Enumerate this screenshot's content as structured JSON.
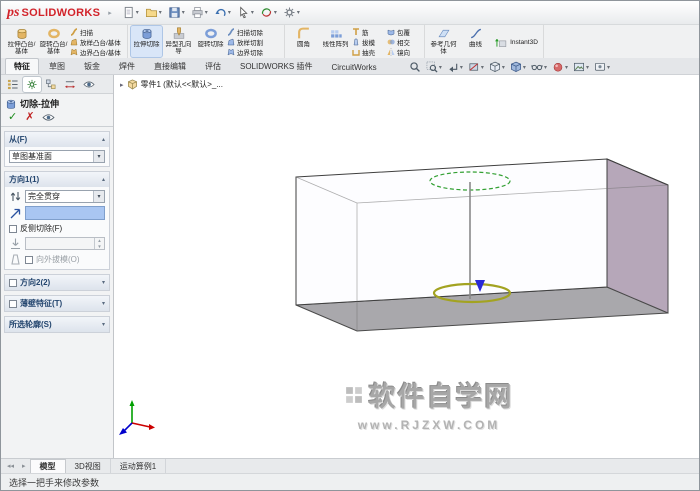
{
  "titlebar": {
    "logo_mark": "ps",
    "logo_text": "SOLIDWORKS"
  },
  "quick_access_icons": [
    "new-document-icon",
    "open-icon",
    "save-icon",
    "print-icon",
    "undo-icon",
    "select-icon",
    "rebuild-icon"
  ],
  "ribbon": {
    "groups": [
      {
        "items": [
          {
            "label": "拉伸凸台/基体",
            "icon": "boss-extrude-icon"
          },
          {
            "label": "旋转凸台/基体",
            "icon": "boss-revolve-icon"
          },
          {
            "items": [
              {
                "label": "扫描",
                "icon": "swept-boss-icon"
              },
              {
                "label": "放样凸台/基体",
                "icon": "lofted-boss-icon"
              },
              {
                "label": "边界凸台/基体",
                "icon": "boundary-boss-icon"
              }
            ]
          }
        ]
      },
      {
        "items": [
          {
            "label": "拉伸切除",
            "icon": "cut-extrude-icon",
            "active": true
          },
          {
            "label": "异型孔向导",
            "icon": "hole-wizard-icon"
          },
          {
            "label": "旋转切除",
            "icon": "cut-revolve-icon"
          },
          {
            "items": [
              {
                "label": "扫描切除",
                "icon": "swept-cut-icon"
              },
              {
                "label": "放样切割",
                "icon": "lofted-cut-icon"
              },
              {
                "label": "边界切除",
                "icon": "boundary-cut-icon"
              }
            ]
          }
        ]
      },
      {
        "items": [
          {
            "label": "圆角",
            "icon": "fillet-icon"
          },
          {
            "label": "线性阵列",
            "icon": "linear-pattern-icon"
          },
          {
            "items": [
              {
                "label": "筋",
                "icon": "rib-icon"
              },
              {
                "label": "拔模",
                "icon": "draft-icon"
              },
              {
                "label": "抽壳",
                "icon": "shell-icon"
              }
            ]
          },
          {
            "items": [
              {
                "label": "包覆",
                "icon": "wrap-icon"
              },
              {
                "label": "相交",
                "icon": "intersect-icon"
              },
              {
                "label": "镜向",
                "icon": "mirror-icon"
              }
            ]
          }
        ]
      },
      {
        "items": [
          {
            "label": "参考几何体",
            "icon": "reference-geometry-icon"
          },
          {
            "label": "曲线",
            "icon": "curves-icon"
          },
          {
            "label": "Instant3D",
            "icon": "instant3d-icon"
          }
        ]
      }
    ]
  },
  "tabs": [
    {
      "label": "特征",
      "active": true
    },
    {
      "label": "草图"
    },
    {
      "label": "钣金"
    },
    {
      "label": "焊件"
    },
    {
      "label": "直接编辑"
    },
    {
      "label": "评估"
    },
    {
      "label": "SOLIDWORKS 插件"
    },
    {
      "label": "CircuitWorks"
    }
  ],
  "heads_up_icons": [
    "zoom-to-fit-icon",
    "zoom-to-area-icon",
    "previous-view-icon",
    "section-view-icon",
    "view-orientation-icon",
    "display-style-icon",
    "hide-show-items-icon",
    "edit-appearance-icon",
    "apply-scene-icon",
    "view-settings-icon"
  ],
  "pm": {
    "tab_icons": [
      "feature-manager-icon",
      "property-manager-icon",
      "configuration-manager-icon",
      "dimxpert-manager-icon",
      "display-manager-icon"
    ],
    "title": "切除-拉伸",
    "sections": {
      "from": {
        "header": "从(F)",
        "value": "草图基准面"
      },
      "direction1": {
        "header": "方向1(1)",
        "end_condition": "完全贯穿",
        "flip_side": "反侧切除(F)",
        "depth": "",
        "draft": "向外拔模(O)"
      },
      "direction2": {
        "header": "方向2(2)"
      },
      "thin": {
        "header": "薄壁特征(T)"
      },
      "contours": {
        "header": "所选轮廓(S)"
      }
    }
  },
  "feature_tree": {
    "root_label": "零件1 (默认<<默认>_..."
  },
  "viewport": {
    "watermark_title": "软件自学网",
    "watermark_url": "www.RJZXW.COM"
  },
  "doc_tabs": [
    {
      "label": "模型",
      "active": true
    },
    {
      "label": "3D视图"
    },
    {
      "label": "运动算例1"
    }
  ],
  "status": {
    "message": "选择一把手来修改参数"
  },
  "colors": {
    "brand_red": "#d2232a",
    "selection_blue": "#a9c6f2",
    "sketch_preview_green": "#33a033",
    "cut_preview_olive": "#a3a321",
    "face_gray": "#a9a8ac",
    "face_purple": "#b6a7b9"
  }
}
